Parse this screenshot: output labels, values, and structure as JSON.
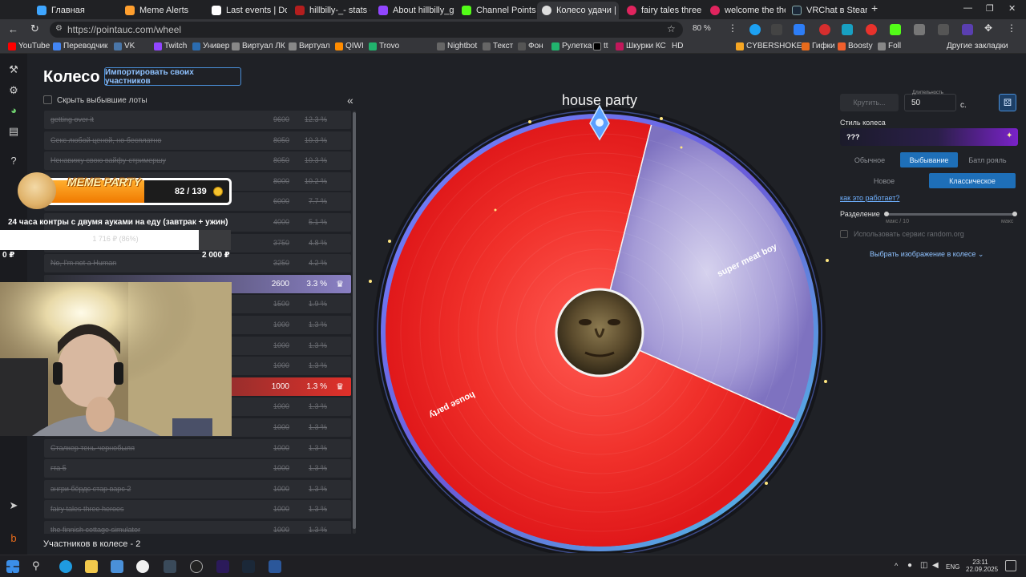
{
  "browser": {
    "tabs": [
      {
        "label": "Главная",
        "color": "#3ea6ff"
      },
      {
        "label": "Meme Alerts",
        "color": "#ff9f2e"
      },
      {
        "label": "Last events | Dona",
        "color": "#222222"
      },
      {
        "label": "hillbilly-_- stats - F",
        "color": "#b41e1e"
      },
      {
        "label": "About hillbilly_gg",
        "color": "#9146ff"
      },
      {
        "label": "Channel Points - K",
        "color": "#53fc18"
      },
      {
        "label": "Колесо удачи |",
        "color": "#dddddd"
      },
      {
        "label": "fairy tales three —",
        "color": "#e0245e"
      },
      {
        "label": "welcome the the v",
        "color": "#e0245e"
      },
      {
        "label": "VRChat в Steam",
        "color": "#1b2838"
      }
    ],
    "url": "https://pointauc.com/wheel",
    "zoom": "80 %",
    "bookmarks": [
      "YouTube",
      "Переводчик",
      "VK",
      "Twitch",
      "Универ",
      "Виртуал ЛК",
      "Виртуал",
      "QIWI",
      "Trovo",
      "Nightbot",
      "Текст",
      "Фон",
      "Рулетка",
      "tt",
      "Шкурки КС",
      "HD",
      "CYBERSHOKE",
      "Гифки",
      "Boosty",
      "Foll",
      "Другие закладки"
    ]
  },
  "page": {
    "title": "Колесо",
    "import_button": "Импортировать своих участников",
    "hide_label": "Скрыть выбывшие лоты",
    "collapse": "«",
    "participants": "Участников в колесе - 2"
  },
  "lots": [
    {
      "name": "getting over it",
      "amount": "9600",
      "pct": "12.3 %",
      "state": "out"
    },
    {
      "name": "Секс любой ценой, но бесплатно",
      "amount": "8050",
      "pct": "10.3 %",
      "state": "out"
    },
    {
      "name": "Ненавижу свою вайфу-стримершу",
      "amount": "8050",
      "pct": "10.3 %",
      "state": "out"
    },
    {
      "name": "",
      "amount": "8000",
      "pct": "10.2 %",
      "state": "out"
    },
    {
      "name": "",
      "amount": "6000",
      "pct": "7.7 %",
      "state": "out"
    },
    {
      "name": "",
      "amount": "4000",
      "pct": "5.1 %",
      "state": "out"
    },
    {
      "name": "",
      "amount": "3750",
      "pct": "4.8 %",
      "state": "out"
    },
    {
      "name": "No, I'm not a Human",
      "amount": "3250",
      "pct": "4.2 %",
      "state": "out"
    },
    {
      "name": "",
      "amount": "2600",
      "pct": "3.3 %",
      "state": "purple"
    },
    {
      "name": "",
      "amount": "1500",
      "pct": "1.9 %",
      "state": "out"
    },
    {
      "name": "",
      "amount": "1000",
      "pct": "1.3 %",
      "state": "out"
    },
    {
      "name": "",
      "amount": "1000",
      "pct": "1.3 %",
      "state": "out"
    },
    {
      "name": "",
      "amount": "1000",
      "pct": "1.3 %",
      "state": "out"
    },
    {
      "name": "",
      "amount": "1000",
      "pct": "1.3 %",
      "state": "red"
    },
    {
      "name": "",
      "amount": "1000",
      "pct": "1.3 %",
      "state": "out"
    },
    {
      "name": "",
      "amount": "1000",
      "pct": "1.3 %",
      "state": "out"
    },
    {
      "name": "Сталкер тень чернобыля",
      "amount": "1000",
      "pct": "1.3 %",
      "state": "out"
    },
    {
      "name": "гта 5",
      "amount": "1000",
      "pct": "1.3 %",
      "state": "out"
    },
    {
      "name": "энгри бёрдс стар варс 2",
      "amount": "1000",
      "pct": "1.3 %",
      "state": "out"
    },
    {
      "name": "fairy tales three heroes",
      "amount": "1000",
      "pct": "1.3 %",
      "state": "out"
    },
    {
      "name": "the finnish cottage simulator",
      "amount": "1000",
      "pct": "1.3 %",
      "state": "out"
    }
  ],
  "overlay": {
    "meme_title": "MEME PARTY",
    "meme_count": "82 / 139",
    "goal_title": "24 часа контры с двумя ауками на еду (завтрак + ужин)",
    "goal_label": "1 716 ₽ (86%)",
    "goal_progress": 0.86,
    "goal_min": "0 ₽",
    "goal_max": "2 000 ₽"
  },
  "wheel": {
    "title": "house party",
    "segments": [
      {
        "label": "house party",
        "value": 2600,
        "color": "#e8201c"
      },
      {
        "label": "super meat boy",
        "value": 1000,
        "color": "#9a90d0"
      }
    ]
  },
  "controls": {
    "spin_button": "Крутить...",
    "duration_label": "Длительность",
    "duration_value": "50",
    "duration_unit": "с.",
    "style_label": "Стиль колеса",
    "style_value": "???",
    "modes": [
      "Обычное",
      "Выбывание",
      "Батл рояль"
    ],
    "mode_active": "Выбывание",
    "sub_modes": [
      "Новое",
      "Классическое"
    ],
    "sub_mode_active": "Классическое",
    "how_link": "как это работает?",
    "split_label": "Разделение",
    "split_min": "макс / 10",
    "split_max": "макс",
    "random_org": "Использовать сервис random.org",
    "image_select": "Выбрать изображение в колесе ⌄"
  },
  "taskbar": {
    "lang": "ENG",
    "time": "23:11",
    "date": "22.09.2025"
  }
}
